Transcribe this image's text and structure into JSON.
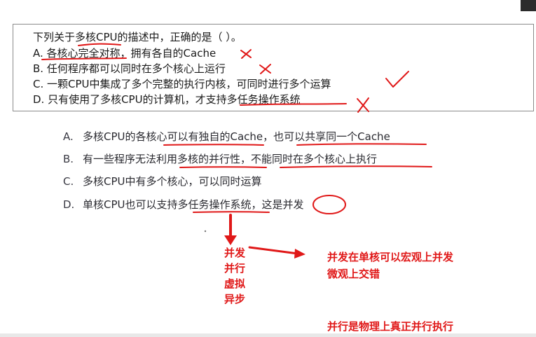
{
  "question": {
    "stem": "下列关于多核CPU的描述中，正确的是（ ）。",
    "options": [
      "A. 各核心完全对称，拥有各自的Cache",
      "B. 任何程序都可以同时在多个核心上运行",
      "C. 一颗CPU中集成了多个完整的执行内核，可同时进行多个运算",
      "D. 只有使用了多核CPU的计算机，才支持多任务操作系统"
    ]
  },
  "analysis": [
    {
      "letter": "A.",
      "text": "多核CPU的各核心可以有独自的Cache，也可以共享同一个Cache"
    },
    {
      "letter": "B.",
      "text": "有一些程序无法利用多核的并行性，不能同时在多个核心上执行"
    },
    {
      "letter": "C.",
      "text": "多核CPU中有多个核心，可以同时运算"
    },
    {
      "letter": "D.",
      "text": "单核CPU也可以支持多任务操作系统，这是并发"
    }
  ],
  "notes": {
    "vertical_words": [
      "并发",
      "并行",
      "虚拟",
      "异步"
    ],
    "concurrency_line1": "并发在单核可以宏观上并发",
    "concurrency_line2": "微观上交错",
    "parallel_line": "并行是物理上真正并行执行"
  },
  "colors": {
    "annotation_red": "#e01818",
    "text": "#1a1a1a",
    "box_border": "#8a8a8a"
  }
}
